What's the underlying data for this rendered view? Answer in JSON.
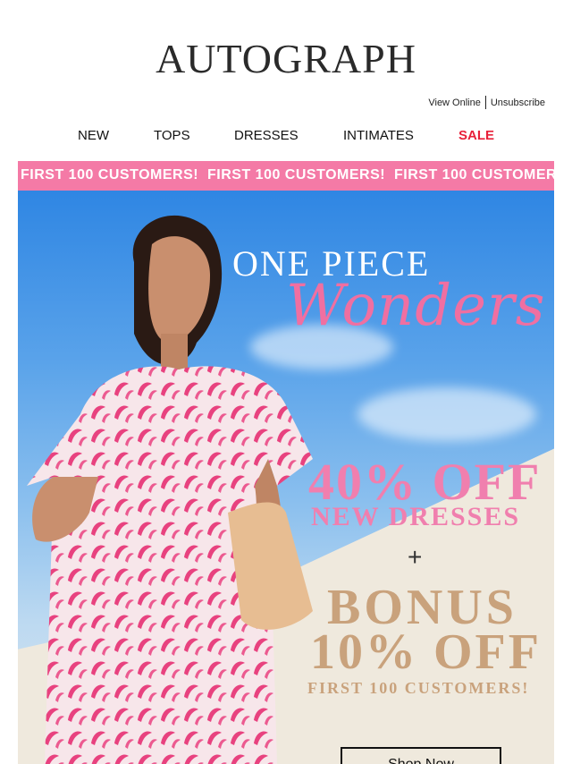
{
  "brand": {
    "logo": "AUTOGRAPH"
  },
  "utility": {
    "view_online": "View Online",
    "unsubscribe": "Unsubscribe"
  },
  "nav": [
    {
      "label": "NEW"
    },
    {
      "label": "TOPS"
    },
    {
      "label": "DRESSES"
    },
    {
      "label": "INTIMATES"
    },
    {
      "label": "SALE"
    }
  ],
  "ticker": {
    "text": "FIRST 100 CUSTOMERS!",
    "color": "#f47aa6"
  },
  "hero": {
    "headline_top": "ONE PIECE",
    "headline_script": "Wonders",
    "offer_line1": "40% OFF",
    "offer_line2": "NEW DRESSES",
    "plus": "+",
    "bonus_line1": "BONUS",
    "bonus_line2": "10% OFF",
    "bonus_line3": "FIRST 100 CUSTOMERS!",
    "cta": "Shop Now"
  },
  "colors": {
    "sale": "#e8213a",
    "pink": "#f07fae",
    "gold": "#c9a27c",
    "sky": "#2f86e3"
  }
}
